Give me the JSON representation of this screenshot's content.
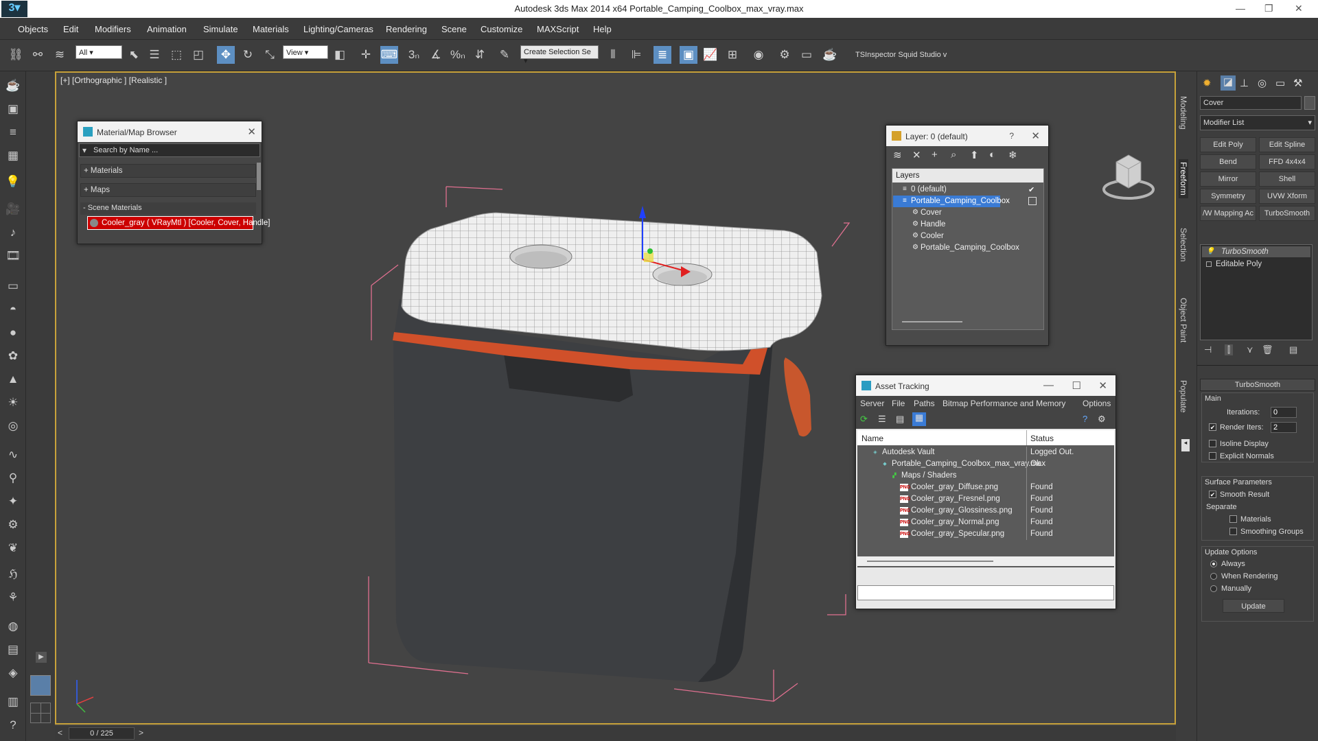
{
  "window": {
    "title": "Autodesk 3ds Max  2014 x64     Portable_Camping_Coolbox_max_vray.max"
  },
  "menu": [
    "Objects",
    "Edit",
    "Modifiers",
    "Animation",
    "Simulate",
    "Materials",
    "Lighting/Cameras",
    "Rendering",
    "Scene",
    "Customize",
    "MAXScript",
    "Help"
  ],
  "toolbar": {
    "selection_filter": "All",
    "ref_coord": "View",
    "named_selection": "Create Selection Se",
    "plugins": "TSInspector  Squid Studio v"
  },
  "viewport": {
    "label": "[+] [Orthographic ] [Realistic ]"
  },
  "timeline": {
    "frame": "0 / 225"
  },
  "material_browser": {
    "title": "Material/Map Browser",
    "search_placeholder": "Search by Name ...",
    "sections": [
      "+ Materials",
      "+ Maps",
      "- Scene Materials"
    ],
    "scene_material": "Cooler_gray  ( VRayMtl ) [Cooler, Cover, Handle]",
    "accent": "#cc0000"
  },
  "layer_dialog": {
    "title": "Layer: 0 (default)",
    "help": "?",
    "header": "Layers",
    "items": [
      {
        "label": "0 (default)",
        "indent": 0,
        "checked": true,
        "selected": false
      },
      {
        "label": "Portable_Camping_Coolbox",
        "indent": 0,
        "checked": false,
        "selected": true
      },
      {
        "label": "Cover",
        "indent": 1,
        "selected": false
      },
      {
        "label": "Handle",
        "indent": 1,
        "selected": false
      },
      {
        "label": "Cooler",
        "indent": 1,
        "selected": false
      },
      {
        "label": "Portable_Camping_Coolbox",
        "indent": 1,
        "selected": false
      }
    ],
    "select_color": "#3a7bd5"
  },
  "asset_tracking": {
    "title": "Asset Tracking",
    "menu": [
      "Server",
      "File",
      "Paths",
      "Bitmap Performance and Memory",
      "Options"
    ],
    "columns": [
      "Name",
      "Status"
    ],
    "rows": [
      {
        "name": "Autodesk Vault",
        "status": "Logged Out.",
        "indent": 0
      },
      {
        "name": "Portable_Camping_Coolbox_max_vray.max",
        "status": "Ok",
        "indent": 1
      },
      {
        "name": "Maps / Shaders",
        "status": "",
        "indent": 2
      },
      {
        "name": "Cooler_gray_Diffuse.png",
        "status": "Found",
        "indent": 3
      },
      {
        "name": "Cooler_gray_Fresnel.png",
        "status": "Found",
        "indent": 3
      },
      {
        "name": "Cooler_gray_Glossiness.png",
        "status": "Found",
        "indent": 3
      },
      {
        "name": "Cooler_gray_Normal.png",
        "status": "Found",
        "indent": 3
      },
      {
        "name": "Cooler_gray_Specular.png",
        "status": "Found",
        "indent": 3
      }
    ]
  },
  "side_tabs": [
    "Modeling",
    "Freeform",
    "Selection",
    "Object Paint",
    "Populate"
  ],
  "command_panel": {
    "object_name": "Cover",
    "modifier_list": "Modifier List",
    "buttons": [
      "Edit Poly",
      "Edit Spline",
      "Bend",
      "FFD 4x4x4",
      "Mirror",
      "Shell",
      "Symmetry",
      "UVW Xform",
      "/W Mapping Ac",
      "TurboSmooth"
    ],
    "stack": [
      "TurboSmooth",
      "Editable Poly"
    ],
    "rollout": "TurboSmooth",
    "main": "Main",
    "iterations_label": "Iterations:",
    "iterations": "0",
    "render_iters_label": "Render Iters:",
    "render_iters": "2",
    "isoline": "Isoline Display",
    "explicit": "Explicit Normals",
    "surface": "Surface Parameters",
    "smooth_result": "Smooth Result",
    "separate": "Separate",
    "materials": "Materials",
    "smoothing_groups": "Smoothing Groups",
    "update_options": "Update Options",
    "always": "Always",
    "when_rendering": "When Rendering",
    "manually": "Manually",
    "update_btn": "Update"
  }
}
